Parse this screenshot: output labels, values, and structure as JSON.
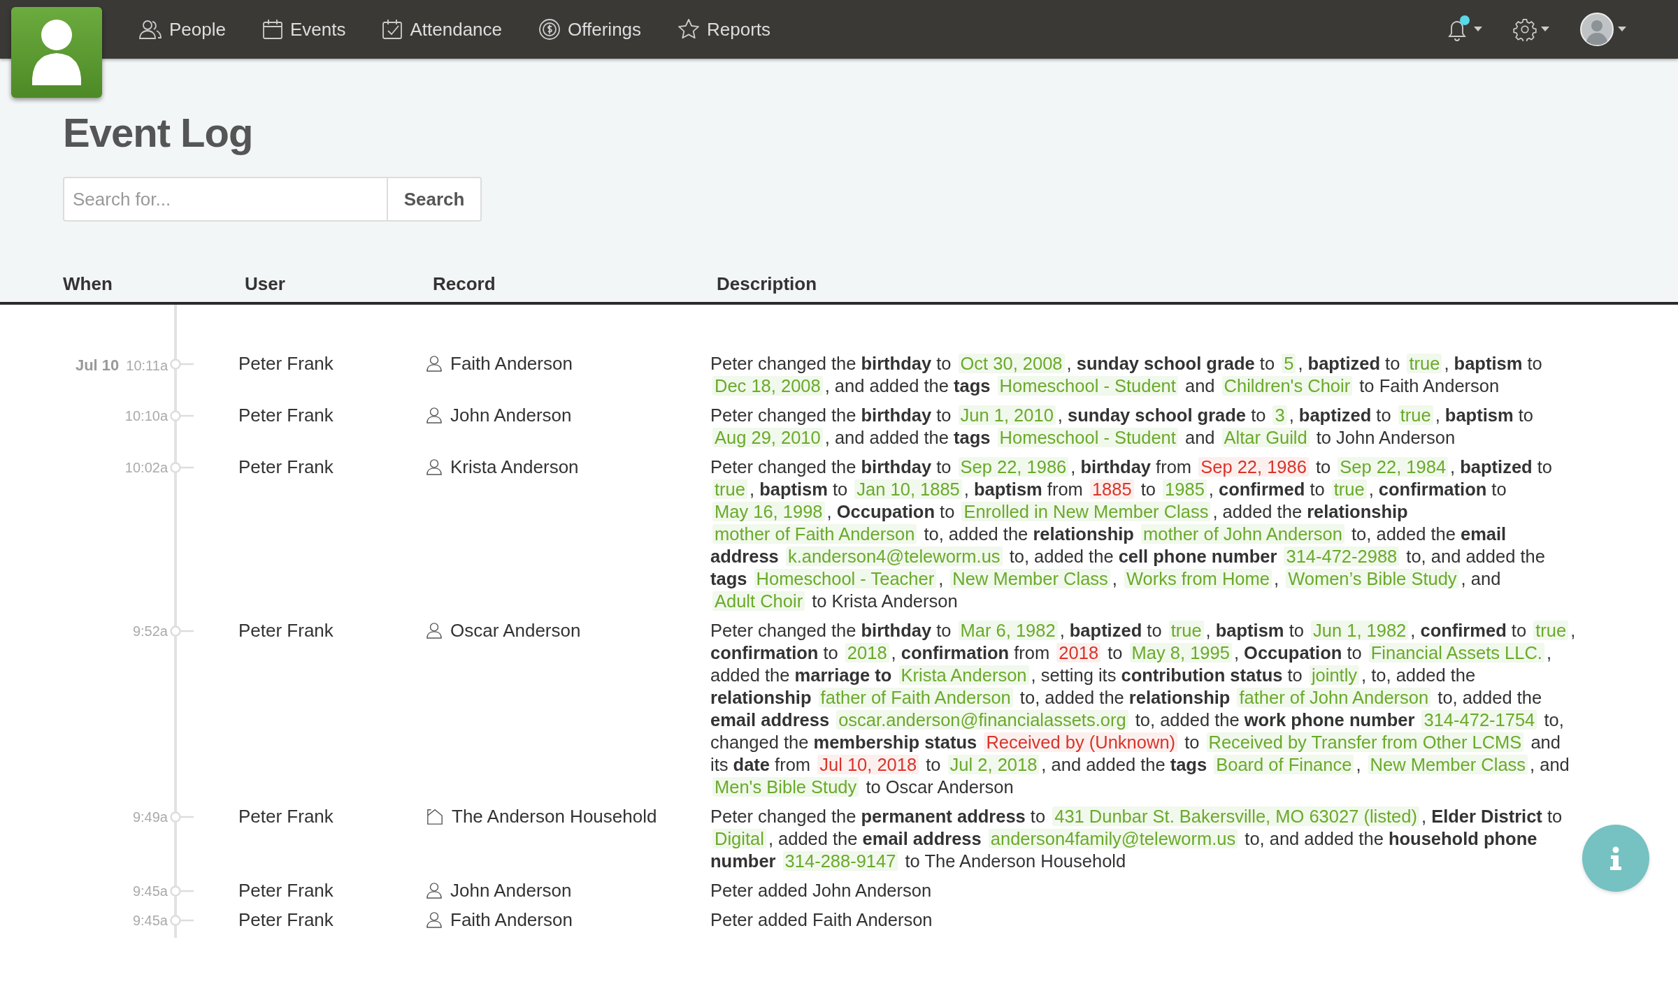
{
  "nav": {
    "items": [
      {
        "kind": "people",
        "label": "People"
      },
      {
        "kind": "events",
        "label": "Events"
      },
      {
        "kind": "attendance",
        "label": "Attendance"
      },
      {
        "kind": "offerings",
        "label": "Offerings"
      },
      {
        "kind": "reports",
        "label": "Reports"
      }
    ],
    "notifications_unread": true
  },
  "page_title": "Event Log",
  "search": {
    "placeholder": "Search for...",
    "button": "Search"
  },
  "table": {
    "columns": [
      "When",
      "User",
      "Record",
      "Description"
    ],
    "rows": [
      {
        "date": "Jul 10",
        "time": "10:11a",
        "user": "Peter Frank",
        "record": {
          "kind": "person",
          "name": "Faith Anderson"
        },
        "description": [
          {
            "kind": "plain",
            "text": "Peter changed the "
          },
          {
            "kind": "bold",
            "text": "birthday"
          },
          {
            "kind": "plain",
            "text": " to "
          },
          {
            "kind": "added",
            "text": "Oct 30, 2008"
          },
          {
            "kind": "plain",
            "text": ", "
          },
          {
            "kind": "bold",
            "text": "sunday school grade"
          },
          {
            "kind": "plain",
            "text": " to "
          },
          {
            "kind": "added",
            "text": "5"
          },
          {
            "kind": "plain",
            "text": ", "
          },
          {
            "kind": "bold",
            "text": "baptized"
          },
          {
            "kind": "plain",
            "text": " to "
          },
          {
            "kind": "added",
            "text": "true"
          },
          {
            "kind": "plain",
            "text": ", "
          },
          {
            "kind": "bold",
            "text": "baptism"
          },
          {
            "kind": "plain",
            "text": " to "
          },
          {
            "kind": "added",
            "text": "Dec 18, 2008"
          },
          {
            "kind": "plain",
            "text": ", and added the "
          },
          {
            "kind": "bold",
            "text": "tags "
          },
          {
            "kind": "added",
            "text": "Homeschool - Student"
          },
          {
            "kind": "plain",
            "text": " and "
          },
          {
            "kind": "added",
            "text": "Children's Choir"
          },
          {
            "kind": "plain",
            "text": " to Faith Anderson"
          }
        ]
      },
      {
        "time": "10:10a",
        "user": "Peter Frank",
        "record": {
          "kind": "person",
          "name": "John Anderson"
        },
        "description": [
          {
            "kind": "plain",
            "text": "Peter changed the "
          },
          {
            "kind": "bold",
            "text": "birthday"
          },
          {
            "kind": "plain",
            "text": " to "
          },
          {
            "kind": "added",
            "text": "Jun 1, 2010"
          },
          {
            "kind": "plain",
            "text": ", "
          },
          {
            "kind": "bold",
            "text": "sunday school grade"
          },
          {
            "kind": "plain",
            "text": " to "
          },
          {
            "kind": "added",
            "text": "3"
          },
          {
            "kind": "plain",
            "text": ", "
          },
          {
            "kind": "bold",
            "text": "baptized"
          },
          {
            "kind": "plain",
            "text": " to "
          },
          {
            "kind": "added",
            "text": "true"
          },
          {
            "kind": "plain",
            "text": ", "
          },
          {
            "kind": "bold",
            "text": "baptism"
          },
          {
            "kind": "plain",
            "text": " to "
          },
          {
            "kind": "added",
            "text": "Aug 29, 2010"
          },
          {
            "kind": "plain",
            "text": ", and added the "
          },
          {
            "kind": "bold",
            "text": "tags "
          },
          {
            "kind": "added",
            "text": "Homeschool - Student"
          },
          {
            "kind": "plain",
            "text": " and "
          },
          {
            "kind": "added",
            "text": "Altar Guild"
          },
          {
            "kind": "plain",
            "text": " to John Anderson"
          }
        ]
      },
      {
        "time": "10:02a",
        "user": "Peter Frank",
        "record": {
          "kind": "person",
          "name": "Krista Anderson"
        },
        "description": [
          {
            "kind": "plain",
            "text": "Peter changed the "
          },
          {
            "kind": "bold",
            "text": "birthday"
          },
          {
            "kind": "plain",
            "text": " to "
          },
          {
            "kind": "added",
            "text": "Sep 22, 1986"
          },
          {
            "kind": "plain",
            "text": ", "
          },
          {
            "kind": "bold",
            "text": "birthday"
          },
          {
            "kind": "plain",
            "text": " from "
          },
          {
            "kind": "removed",
            "text": "Sep 22, 1986"
          },
          {
            "kind": "plain",
            "text": " to "
          },
          {
            "kind": "added",
            "text": "Sep 22, 1984"
          },
          {
            "kind": "plain",
            "text": ", "
          },
          {
            "kind": "bold",
            "text": "baptized"
          },
          {
            "kind": "plain",
            "text": " to "
          },
          {
            "kind": "added",
            "text": "true"
          },
          {
            "kind": "plain",
            "text": ", "
          },
          {
            "kind": "bold",
            "text": "baptism"
          },
          {
            "kind": "plain",
            "text": " to "
          },
          {
            "kind": "added",
            "text": "Jan 10, 1885"
          },
          {
            "kind": "plain",
            "text": ", "
          },
          {
            "kind": "bold",
            "text": "baptism"
          },
          {
            "kind": "plain",
            "text": " from "
          },
          {
            "kind": "removed",
            "text": "1885"
          },
          {
            "kind": "plain",
            "text": " to "
          },
          {
            "kind": "added",
            "text": "1985"
          },
          {
            "kind": "plain",
            "text": ", "
          },
          {
            "kind": "bold",
            "text": "confirmed"
          },
          {
            "kind": "plain",
            "text": " to "
          },
          {
            "kind": "added",
            "text": "true"
          },
          {
            "kind": "plain",
            "text": ", "
          },
          {
            "kind": "bold",
            "text": "confirmation"
          },
          {
            "kind": "plain",
            "text": " to "
          },
          {
            "kind": "added",
            "text": "May 16, 1998"
          },
          {
            "kind": "plain",
            "text": ", "
          },
          {
            "kind": "bold",
            "text": "Occupation"
          },
          {
            "kind": "plain",
            "text": " to "
          },
          {
            "kind": "added",
            "text": "Enrolled in New Member Class"
          },
          {
            "kind": "plain",
            "text": ", added the "
          },
          {
            "kind": "bold",
            "text": "relationship "
          },
          {
            "kind": "added",
            "text": "mother of Faith Anderson"
          },
          {
            "kind": "plain",
            "text": " to, added the "
          },
          {
            "kind": "bold",
            "text": "relationship "
          },
          {
            "kind": "added",
            "text": "mother of John Anderson"
          },
          {
            "kind": "plain",
            "text": " to, added the "
          },
          {
            "kind": "bold",
            "text": "email address "
          },
          {
            "kind": "added",
            "text": "k.anderson4@teleworm.us"
          },
          {
            "kind": "plain",
            "text": " to, added the "
          },
          {
            "kind": "bold",
            "text": "cell phone number "
          },
          {
            "kind": "added",
            "text": "314-472-2988"
          },
          {
            "kind": "plain",
            "text": " to, and added the "
          },
          {
            "kind": "bold",
            "text": "tags "
          },
          {
            "kind": "added",
            "text": "Homeschool - Teacher"
          },
          {
            "kind": "plain",
            "text": ", "
          },
          {
            "kind": "added",
            "text": "New Member Class"
          },
          {
            "kind": "plain",
            "text": ", "
          },
          {
            "kind": "added",
            "text": "Works from Home"
          },
          {
            "kind": "plain",
            "text": ", "
          },
          {
            "kind": "added",
            "text": "Women’s Bible Study"
          },
          {
            "kind": "plain",
            "text": ", and "
          },
          {
            "kind": "added",
            "text": "Adult Choir"
          },
          {
            "kind": "plain",
            "text": " to Krista Anderson"
          }
        ]
      },
      {
        "time": "9:52a",
        "user": "Peter Frank",
        "record": {
          "kind": "person",
          "name": "Oscar Anderson"
        },
        "description": [
          {
            "kind": "plain",
            "text": "Peter changed the "
          },
          {
            "kind": "bold",
            "text": "birthday"
          },
          {
            "kind": "plain",
            "text": " to "
          },
          {
            "kind": "added",
            "text": "Mar 6, 1982"
          },
          {
            "kind": "plain",
            "text": ", "
          },
          {
            "kind": "bold",
            "text": "baptized"
          },
          {
            "kind": "plain",
            "text": " to "
          },
          {
            "kind": "added",
            "text": "true"
          },
          {
            "kind": "plain",
            "text": ", "
          },
          {
            "kind": "bold",
            "text": "baptism"
          },
          {
            "kind": "plain",
            "text": " to "
          },
          {
            "kind": "added",
            "text": "Jun 1, 1982"
          },
          {
            "kind": "plain",
            "text": ", "
          },
          {
            "kind": "bold",
            "text": "confirmed"
          },
          {
            "kind": "plain",
            "text": " to "
          },
          {
            "kind": "added",
            "text": "true"
          },
          {
            "kind": "plain",
            "text": ", "
          },
          {
            "kind": "bold",
            "text": "confirmation"
          },
          {
            "kind": "plain",
            "text": " to "
          },
          {
            "kind": "added",
            "text": "2018"
          },
          {
            "kind": "plain",
            "text": ", "
          },
          {
            "kind": "bold",
            "text": "confirmation"
          },
          {
            "kind": "plain",
            "text": " from "
          },
          {
            "kind": "removed",
            "text": "2018"
          },
          {
            "kind": "plain",
            "text": " to "
          },
          {
            "kind": "added",
            "text": "May 8, 1995"
          },
          {
            "kind": "plain",
            "text": ", "
          },
          {
            "kind": "bold",
            "text": "Occupation"
          },
          {
            "kind": "plain",
            "text": " to "
          },
          {
            "kind": "added",
            "text": "Financial Assets LLC."
          },
          {
            "kind": "plain",
            "text": ", added the "
          },
          {
            "kind": "bold",
            "text": "marriage to "
          },
          {
            "kind": "added",
            "text": "Krista Anderson"
          },
          {
            "kind": "plain",
            "text": ", setting its "
          },
          {
            "kind": "bold",
            "text": "contribution status"
          },
          {
            "kind": "plain",
            "text": " to "
          },
          {
            "kind": "added",
            "text": "jointly"
          },
          {
            "kind": "plain",
            "text": ", to, added the "
          },
          {
            "kind": "bold",
            "text": "relationship "
          },
          {
            "kind": "added",
            "text": "father of Faith Anderson"
          },
          {
            "kind": "plain",
            "text": " to, added the "
          },
          {
            "kind": "bold",
            "text": "relationship "
          },
          {
            "kind": "added",
            "text": "father of John Anderson"
          },
          {
            "kind": "plain",
            "text": " to, added the "
          },
          {
            "kind": "bold",
            "text": "email address "
          },
          {
            "kind": "added",
            "text": "oscar.anderson@financialassets.org"
          },
          {
            "kind": "plain",
            "text": " to, added the "
          },
          {
            "kind": "bold",
            "text": "work phone number "
          },
          {
            "kind": "added",
            "text": "314-472-1754"
          },
          {
            "kind": "plain",
            "text": " to, changed the "
          },
          {
            "kind": "bold",
            "text": "membership status "
          },
          {
            "kind": "removed",
            "text": "Received by (Unknown)"
          },
          {
            "kind": "plain",
            "text": " to "
          },
          {
            "kind": "added",
            "text": "Received by Transfer from Other LCMS"
          },
          {
            "kind": "plain",
            "text": " and its "
          },
          {
            "kind": "bold",
            "text": "date"
          },
          {
            "kind": "plain",
            "text": " from "
          },
          {
            "kind": "removed",
            "text": "Jul 10, 2018"
          },
          {
            "kind": "plain",
            "text": " to "
          },
          {
            "kind": "added",
            "text": "Jul 2, 2018"
          },
          {
            "kind": "plain",
            "text": ", and added the "
          },
          {
            "kind": "bold",
            "text": "tags "
          },
          {
            "kind": "added",
            "text": "Board of Finance"
          },
          {
            "kind": "plain",
            "text": ", "
          },
          {
            "kind": "added",
            "text": "New Member Class"
          },
          {
            "kind": "plain",
            "text": ", and "
          },
          {
            "kind": "added",
            "text": "Men's Bible Study"
          },
          {
            "kind": "plain",
            "text": " to Oscar Anderson"
          }
        ]
      },
      {
        "time": "9:49a",
        "user": "Peter Frank",
        "record": {
          "kind": "household",
          "name": "The Anderson Household"
        },
        "description": [
          {
            "kind": "plain",
            "text": "Peter changed the "
          },
          {
            "kind": "bold",
            "text": "permanent address"
          },
          {
            "kind": "plain",
            "text": " to "
          },
          {
            "kind": "added",
            "text": "431 Dunbar St. Bakersville, MO 63027 (listed)"
          },
          {
            "kind": "plain",
            "text": ", "
          },
          {
            "kind": "bold",
            "text": "Elder District"
          },
          {
            "kind": "plain",
            "text": " to "
          },
          {
            "kind": "added",
            "text": "Digital"
          },
          {
            "kind": "plain",
            "text": ", added the "
          },
          {
            "kind": "bold",
            "text": "email address "
          },
          {
            "kind": "added",
            "text": "anderson4family@teleworm.us"
          },
          {
            "kind": "plain",
            "text": " to, and added the "
          },
          {
            "kind": "bold",
            "text": "household phone number "
          },
          {
            "kind": "added",
            "text": "314-288-9147"
          },
          {
            "kind": "plain",
            "text": " to The Anderson Household"
          }
        ]
      },
      {
        "time": "9:45a",
        "user": "Peter Frank",
        "record": {
          "kind": "person",
          "name": "John Anderson"
        },
        "description": [
          {
            "kind": "plain",
            "text": "Peter added John Anderson"
          }
        ]
      },
      {
        "time": "9:45a",
        "user": "Peter Frank",
        "record": {
          "kind": "person",
          "name": "Faith Anderson"
        },
        "description": [
          {
            "kind": "plain",
            "text": "Peter added Faith Anderson"
          }
        ]
      }
    ]
  }
}
